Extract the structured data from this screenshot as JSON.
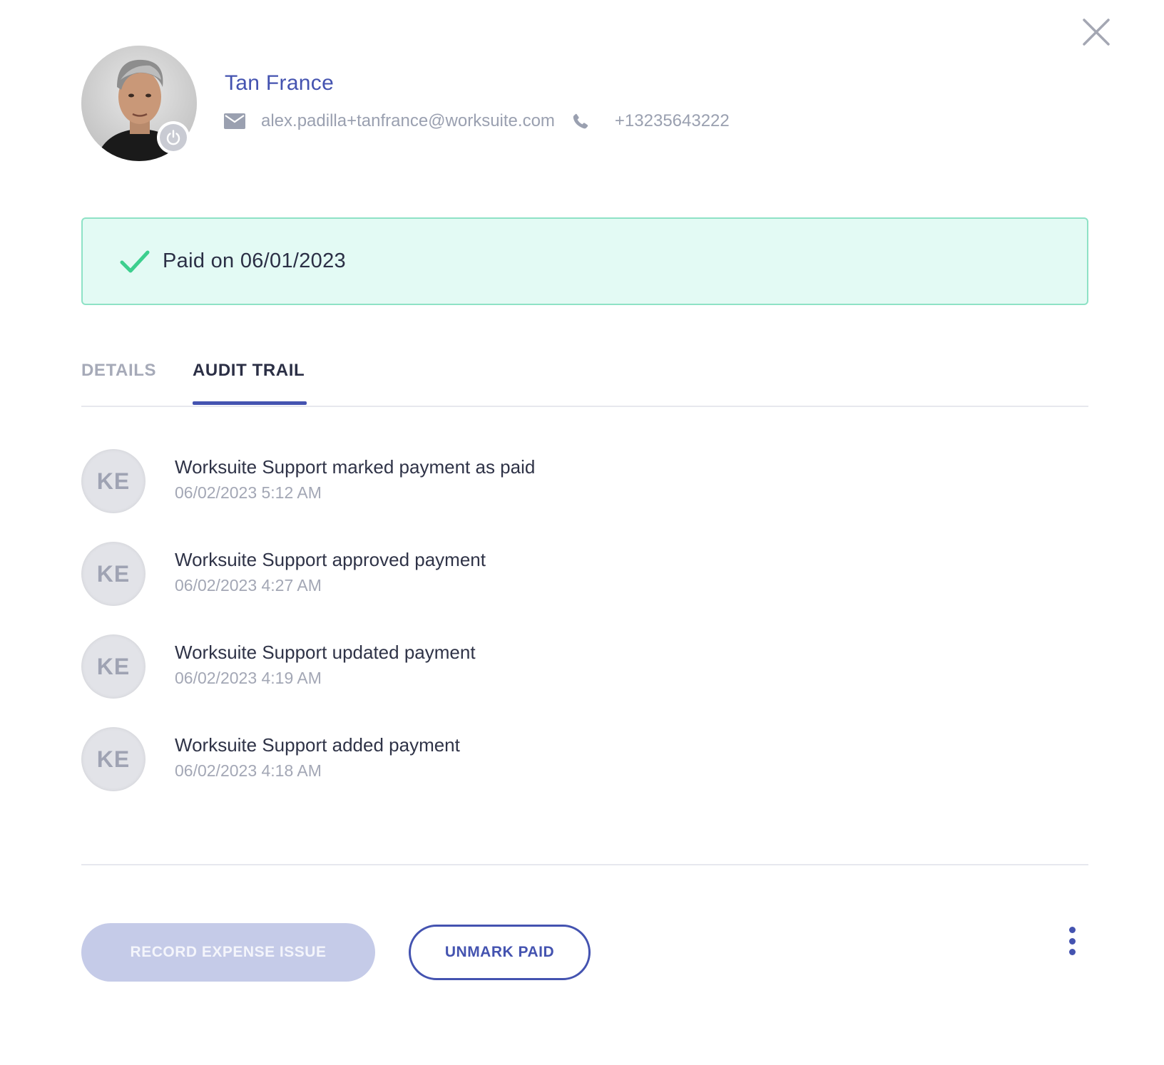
{
  "user": {
    "name": "Tan France",
    "email": "alex.padilla+tanfrance@worksuite.com",
    "phone": "+13235643222"
  },
  "status_banner": {
    "text": "Paid on 06/01/2023",
    "icon": "check-icon",
    "color": "#3ccf8e"
  },
  "tabs": [
    {
      "label": "DETAILS",
      "active": false
    },
    {
      "label": "AUDIT TRAIL",
      "active": true
    }
  ],
  "audit_trail": [
    {
      "initials": "KE",
      "text": "Worksuite Support marked payment as paid",
      "time": "06/02/2023 5:12 AM"
    },
    {
      "initials": "KE",
      "text": "Worksuite Support approved payment",
      "time": "06/02/2023 4:27 AM"
    },
    {
      "initials": "KE",
      "text": "Worksuite Support updated payment",
      "time": "06/02/2023 4:19 AM"
    },
    {
      "initials": "KE",
      "text": "Worksuite Support added payment",
      "time": "06/02/2023 4:18 AM"
    }
  ],
  "actions": {
    "record_label": "RECORD EXPENSE ISSUE",
    "unmark_label": "UNMARK PAID"
  },
  "colors": {
    "accent": "#4453b0",
    "success_bg": "#e3faf4",
    "success_border": "#8ee2c6",
    "muted_text": "#9aa0b0"
  }
}
